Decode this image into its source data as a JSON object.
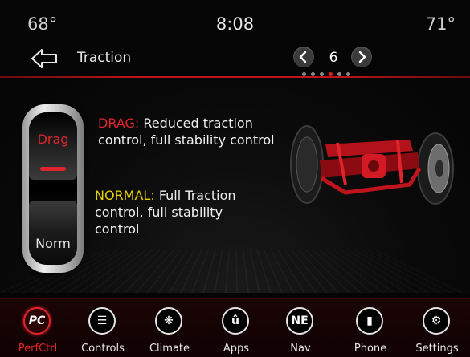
{
  "status": {
    "temp_left": "68°",
    "clock": "8:08",
    "temp_right": "71°"
  },
  "header": {
    "title": "Traction",
    "page_number": "6",
    "page_count": 6,
    "active_page": 4
  },
  "switch": {
    "drag_label": "Drag",
    "norm_label": "Norm",
    "selected": "Drag"
  },
  "descriptions": {
    "drag_prefix": "DRAG:",
    "drag_text": " Reduced traction control, full stability control",
    "normal_prefix": "NORMAL:",
    "normal_text": " Full Traction control, full stability control"
  },
  "nav": [
    {
      "id": "perfctrl",
      "label": "PerfCtrl",
      "icon": "PC",
      "icon_name": "performance-control-icon"
    },
    {
      "id": "controls",
      "label": "Controls",
      "icon": "☰",
      "icon_name": "hand-controls-icon"
    },
    {
      "id": "climate",
      "label": "Climate",
      "icon": "❋",
      "icon_name": "climate-icon"
    },
    {
      "id": "apps",
      "label": "Apps",
      "icon": "û",
      "icon_name": "uconnect-apps-icon"
    },
    {
      "id": "nav",
      "label": "Nav",
      "icon": "NE",
      "icon_name": "compass-icon"
    },
    {
      "id": "phone",
      "label": "Phone",
      "icon": "▮",
      "icon_name": "phone-signal-icon"
    },
    {
      "id": "settings",
      "label": "Settings",
      "icon": "⚙",
      "icon_name": "gear-icon"
    }
  ],
  "colors": {
    "accent_red": "#e0242d",
    "normal_yellow": "#e8d000",
    "background": "#050505"
  }
}
